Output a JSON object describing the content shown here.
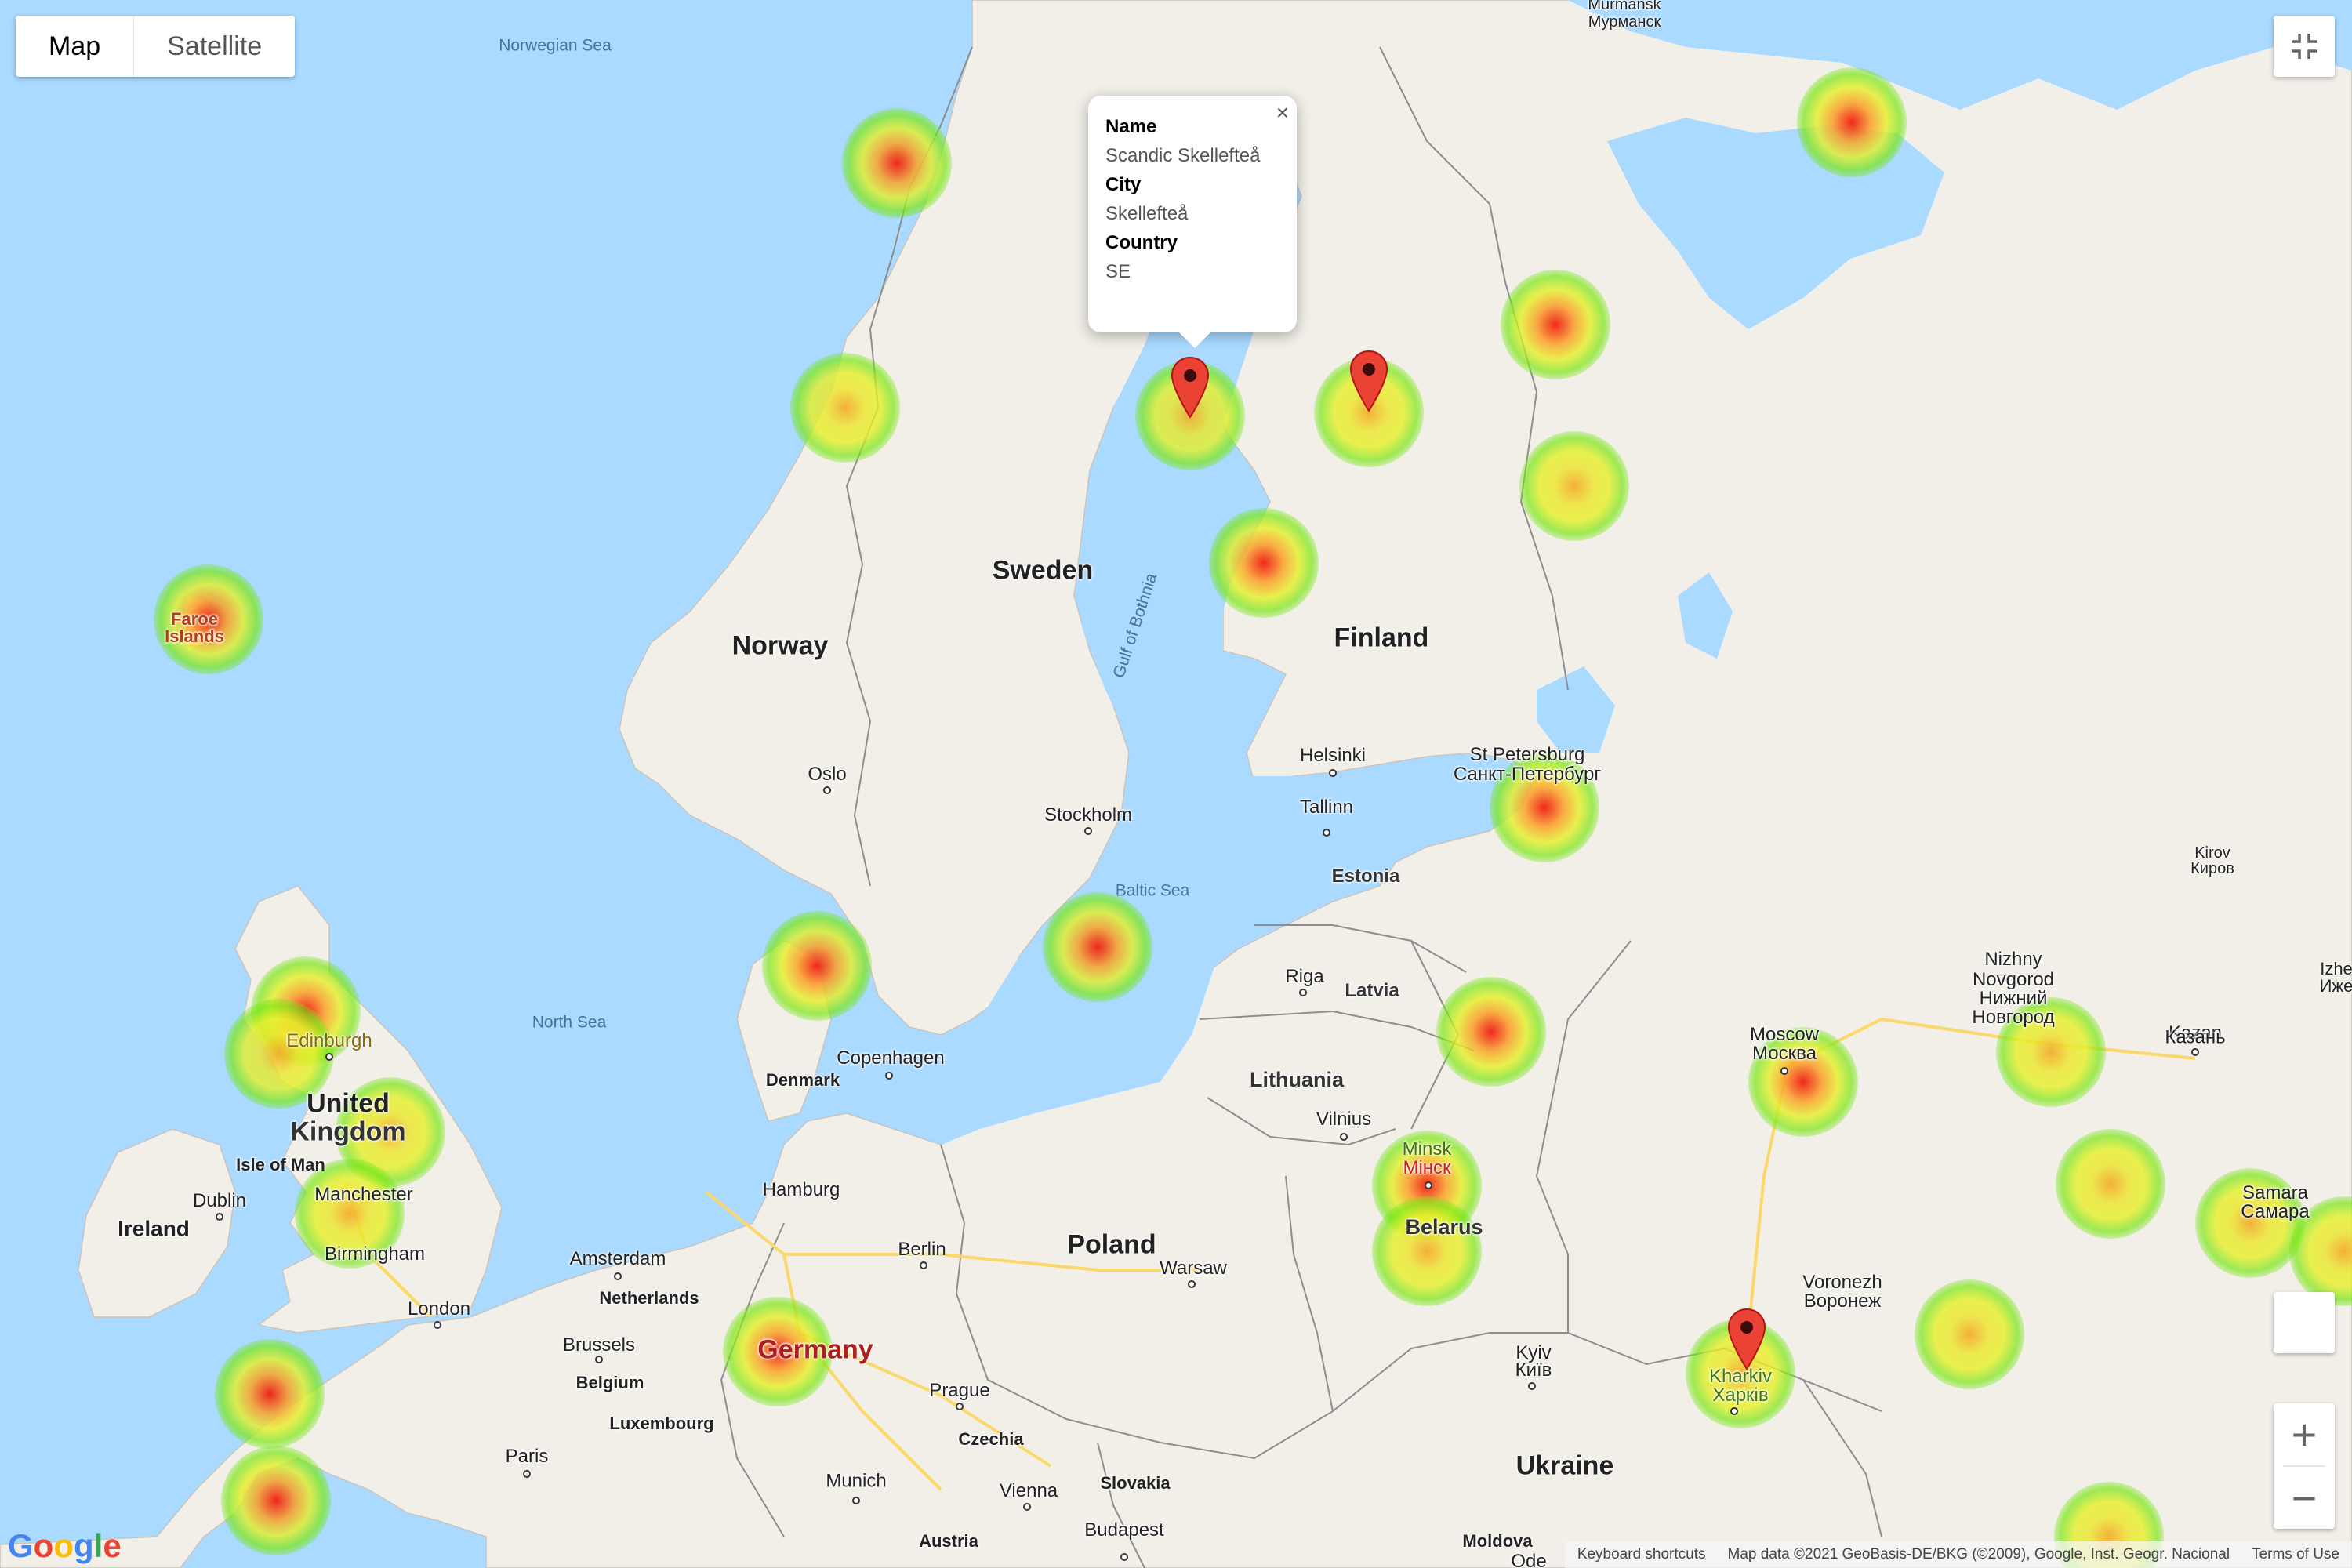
{
  "map_type": {
    "map_label": "Map",
    "satellite_label": "Satellite",
    "selected": "Map"
  },
  "info_window": {
    "name_heading": "Name",
    "name_value": "Scandic Skellefteå",
    "city_heading": "City",
    "city_value": "Skellefteå",
    "country_heading": "Country",
    "country_value": "SE",
    "close_glyph": "×"
  },
  "labels": {
    "norwegian_sea": "Norwegian Sea",
    "murmansk": "Murmansk",
    "murmansk_ru": "Мурманск",
    "sweden": "Sweden",
    "norway": "Norway",
    "finland": "Finland",
    "gulf_of_bothnia": "Gulf of Bothnia",
    "faroe_islands_1": "Faroe",
    "faroe_islands_2": "Islands",
    "helsinki": "Helsinki",
    "st_petersburg": "St Petersburg",
    "st_petersburg_ru": "Санкт-Петербург",
    "oslo": "Oslo",
    "stockholm": "Stockholm",
    "tallinn": "Tallinn",
    "estonia": "Estonia",
    "baltic_sea": "Baltic Sea",
    "kirov": "Kirov",
    "kirov_ru": "Киров",
    "riga": "Riga",
    "latvia": "Latvia",
    "nizhny_1": "Nizhny",
    "nizhny_2": "Novgorod",
    "nizhny_ru_1": "Нижний",
    "nizhny_ru_2": "Новгород",
    "izhevsk_1": "Izhe",
    "izhevsk_2": "Иже",
    "north_sea": "North Sea",
    "copenhagen": "Copenhagen",
    "denmark": "Denmark",
    "edinburgh": "Edinburgh",
    "lithuania": "Lithuania",
    "moscow": "Moscow",
    "moscow_ru": "Москва",
    "kazan": "Kazan",
    "kazan_ru": "Казань",
    "united_kingdom_1": "United",
    "united_kingdom_2": "Kingdom",
    "vilnius": "Vilnius",
    "isle_of_man": "Isle of Man",
    "minsk": "Minsk",
    "minsk_ru": "Мінск",
    "dublin": "Dublin",
    "manchester": "Manchester",
    "hamburg": "Hamburg",
    "samara": "Samara",
    "samara_ru": "Самара",
    "ireland": "Ireland",
    "belarus": "Belarus",
    "poland": "Poland",
    "berlin": "Berlin",
    "amsterdam": "Amsterdam",
    "birmingham": "Birmingham",
    "warsaw": "Warsaw",
    "voronezh": "Voronezh",
    "voronezh_ru": "Воронеж",
    "netherlands": "Netherlands",
    "london": "London",
    "brussels": "Brussels",
    "germany": "Germany",
    "belgium": "Belgium",
    "kyiv": "Kyiv",
    "kyiv_ua": "Київ",
    "kharkiv": "Kharkiv",
    "kharkiv_ua": "Харків",
    "prague": "Prague",
    "luxembourg": "Luxembourg",
    "czechia": "Czechia",
    "paris": "Paris",
    "ukraine": "Ukraine",
    "slovakia": "Slovakia",
    "munich": "Munich",
    "vienna": "Vienna",
    "budapest": "Budapest",
    "austria": "Austria",
    "moldova": "Moldova",
    "odesa_partial": "Ode"
  },
  "branding": {
    "google": "Google"
  },
  "footer": {
    "shortcuts": "Keyboard shortcuts",
    "map_data": "Map data ©2021 GeoBasis-DE/BKG (©2009), Google, Inst. Geogr. Nacional",
    "terms": "Terms of Use"
  },
  "controls": {
    "zoom_in": "+",
    "zoom_out": "−"
  },
  "colors": {
    "water": "#aadaff",
    "land": "#f2efe9",
    "marker": "#ea4335"
  },
  "heatmap": {
    "gradient": [
      "#ff0000",
      "#ffa500",
      "#ffff00",
      "#7cfc00"
    ]
  }
}
